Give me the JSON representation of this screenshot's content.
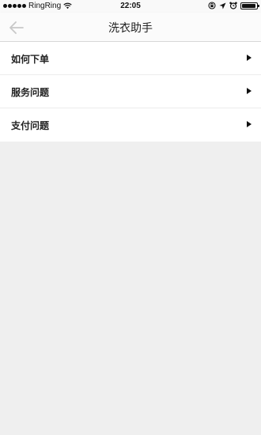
{
  "status_bar": {
    "carrier": "RingRing",
    "time": "22:05",
    "battery_level": 0.95
  },
  "nav": {
    "title": "洗衣助手",
    "back_icon": "back-arrow-icon"
  },
  "menu": {
    "items": [
      {
        "label": "如何下单",
        "icon": "triangle-right-icon"
      },
      {
        "label": "服务问题",
        "icon": "triangle-right-icon"
      },
      {
        "label": "支付问题",
        "icon": "triangle-right-icon"
      }
    ]
  },
  "colors": {
    "background": "#efefef",
    "surface": "#ffffff",
    "text": "#222222"
  }
}
